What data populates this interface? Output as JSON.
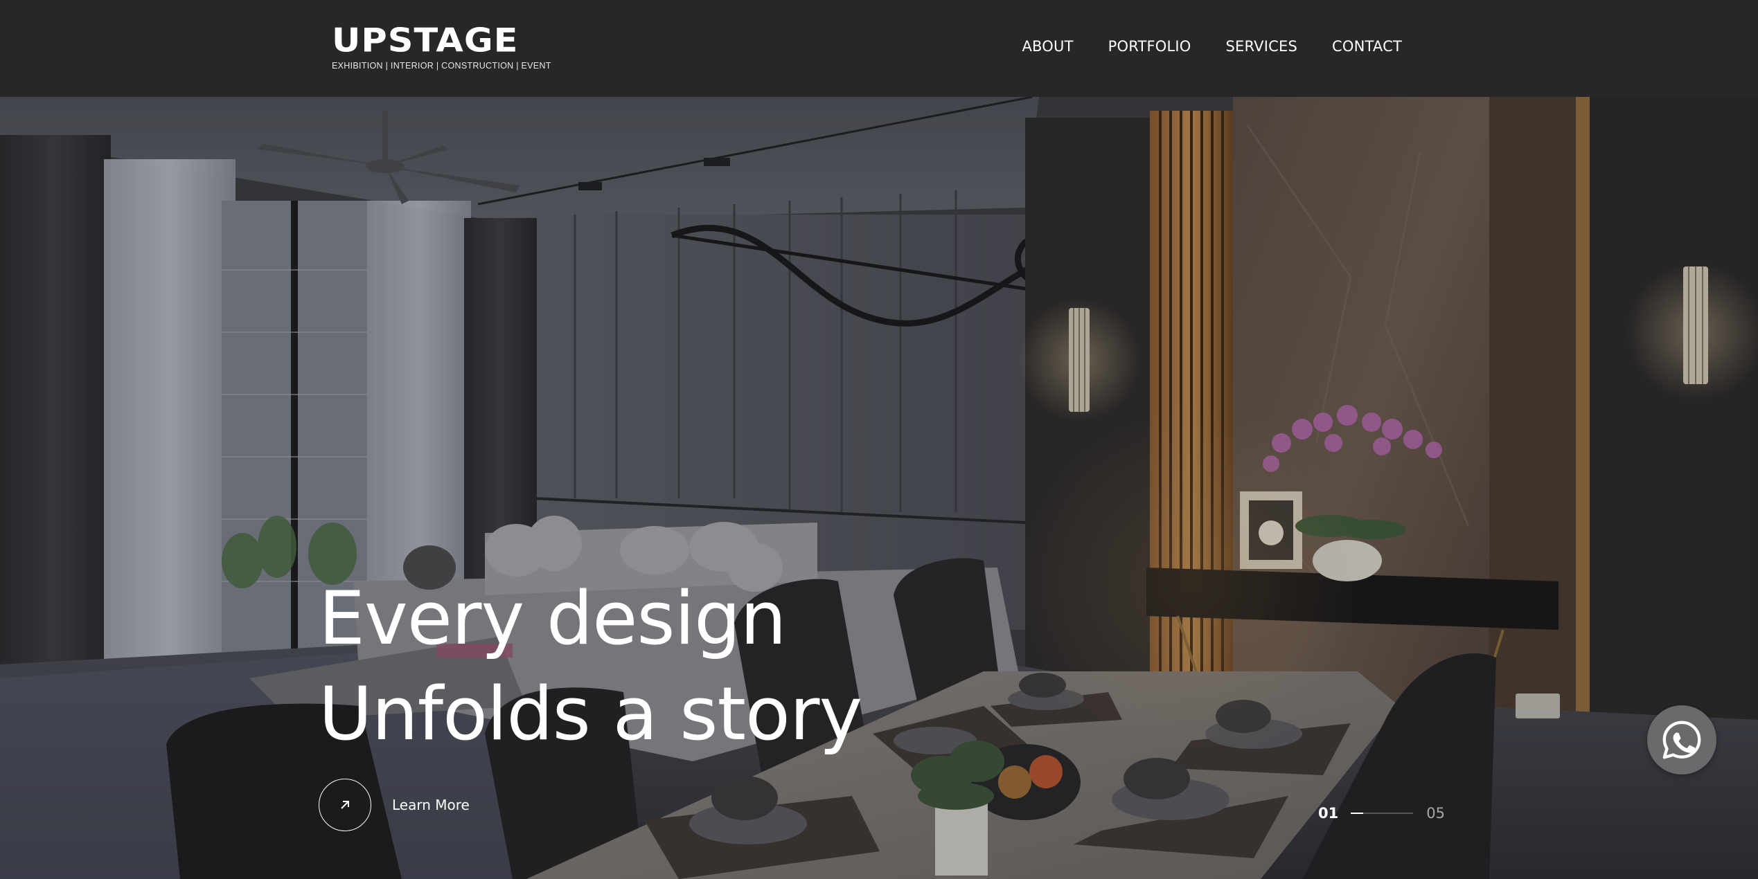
{
  "header": {
    "logo_text": "UPSTAGE",
    "logo_tagline": "EXHIBITION | INTERIOR | CONSTRUCTION | EVENT",
    "nav": [
      {
        "label": "ABOUT"
      },
      {
        "label": "PORTFOLIO"
      },
      {
        "label": "SERVICES"
      },
      {
        "label": "CONTACT"
      }
    ]
  },
  "hero": {
    "headline_line1": "Every design",
    "headline_line2": "Unfolds a story",
    "cta_label": "Learn More",
    "cta_icon": "arrow-up-right-icon",
    "slider": {
      "current": "01",
      "total": "05",
      "progress": 0.2
    }
  },
  "floating": {
    "whatsapp_icon": "whatsapp-icon"
  },
  "colors": {
    "header_bg": "#272727",
    "text": "#ffffff",
    "whatsapp_bg": "#6a6a6a"
  }
}
